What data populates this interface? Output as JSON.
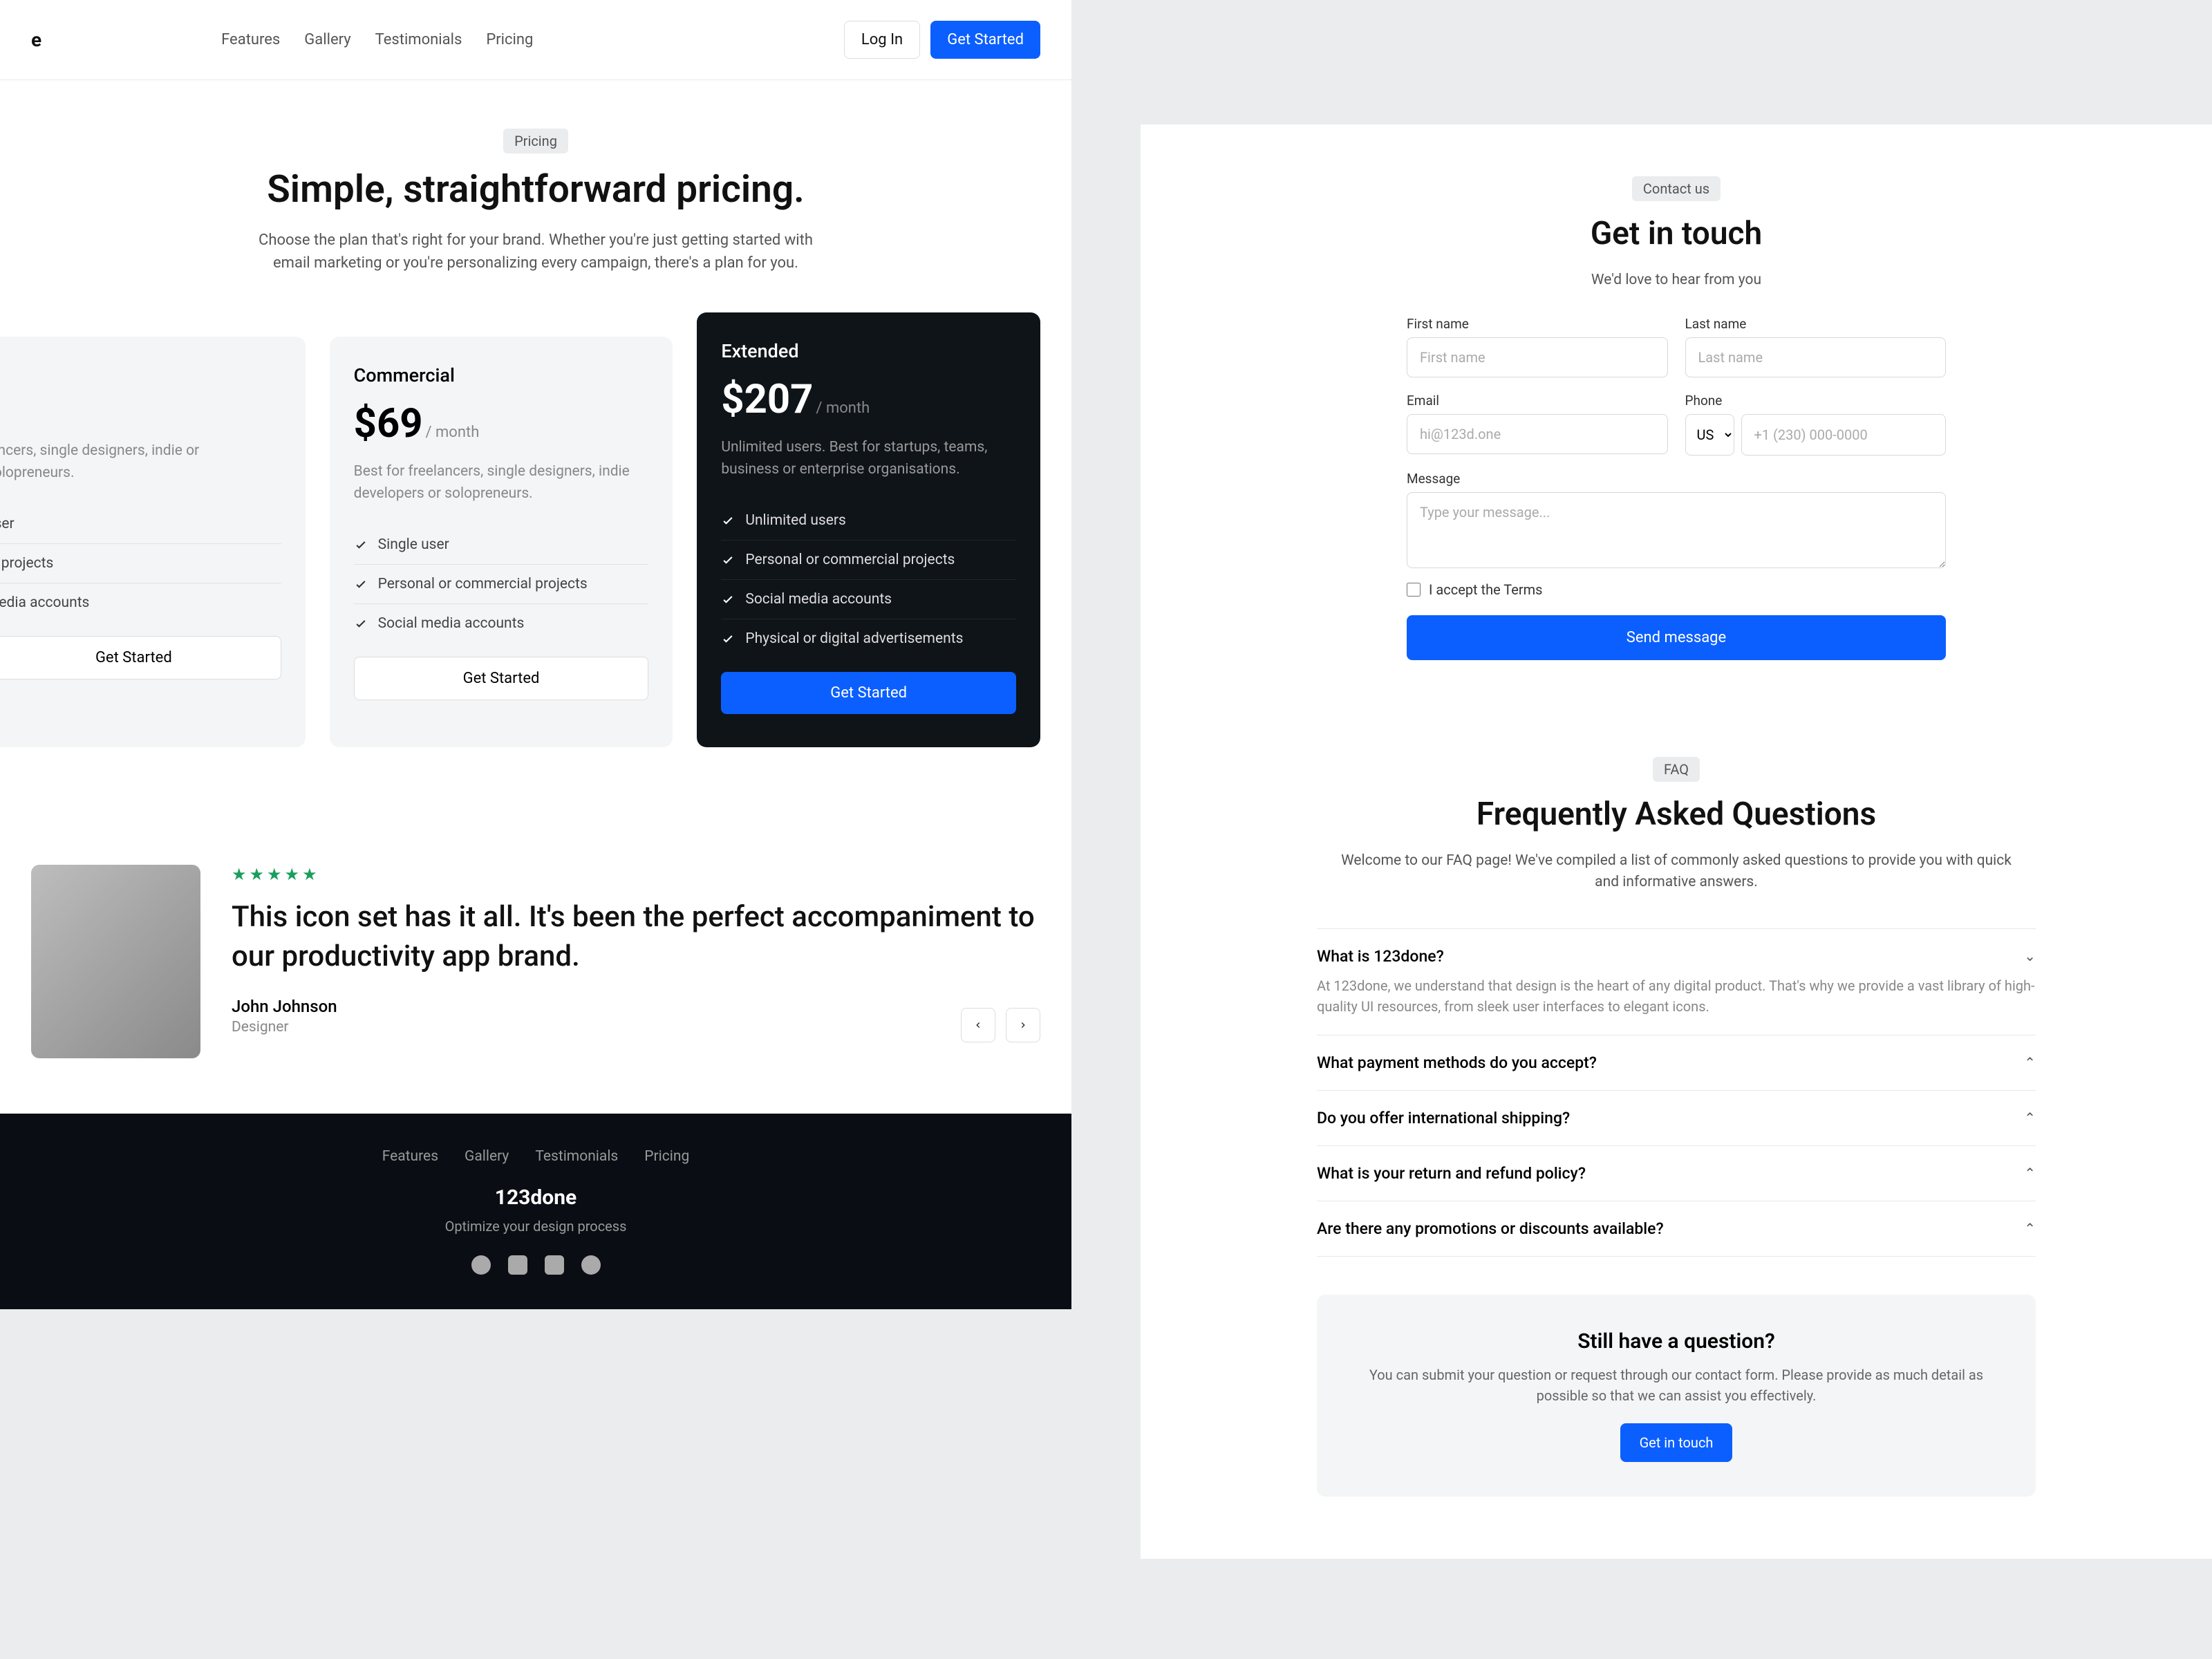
{
  "nav": {
    "logo": "e",
    "links": [
      "Features",
      "Gallery",
      "Testimonials",
      "Pricing"
    ],
    "login": "Log In",
    "getStarted": "Get Started"
  },
  "pricing": {
    "tag": "Pricing",
    "title": "Simple, straightforward pricing.",
    "sub": "Choose the plan that's right for your brand. Whether you're just getting started with email marketing or you're personalizing every campaign, there's a plan for you.",
    "cards": [
      {
        "name": "",
        "price": "",
        "unit": "",
        "desc": "lancers, single designers, indie or solopreneurs.",
        "features": [
          "user",
          "al projects",
          "media accounts"
        ],
        "cta": "Get Started"
      },
      {
        "name": "Commercial",
        "price": "$69",
        "unit": "/ month",
        "desc": "Best for freelancers, single designers, indie developers or solopreneurs.",
        "features": [
          "Single user",
          "Personal or commercial projects",
          "Social media accounts"
        ],
        "cta": "Get Started"
      },
      {
        "name": "Extended",
        "price": "$207",
        "unit": "/ month",
        "desc": "Unlimited users. Best for startups, teams, business or enterprise organisations.",
        "features": [
          "Unlimited users",
          "Personal or commercial projects",
          "Social media accounts",
          "Physical or digital advertisements"
        ],
        "cta": "Get Started"
      }
    ]
  },
  "testimonial": {
    "quote": "This icon set has it all. It's been the perfect accompaniment to our productivity app brand.",
    "author": "John Johnson",
    "role": "Designer"
  },
  "footer": {
    "links": [
      "Features",
      "Gallery",
      "Testimonials",
      "Pricing"
    ],
    "logo": "123done",
    "tagline": "Optimize your design process"
  },
  "contact": {
    "tag": "Contact us",
    "title": "Get in touch",
    "sub": "We'd love to hear from you",
    "fields": {
      "firstName": {
        "label": "First name",
        "ph": "First name"
      },
      "lastName": {
        "label": "Last name",
        "ph": "Last name"
      },
      "email": {
        "label": "Email",
        "ph": "hi@123d.one"
      },
      "phone": {
        "label": "Phone",
        "cc": "US",
        "ph": "+1 (230) 000-0000"
      },
      "message": {
        "label": "Message",
        "ph": "Type your message..."
      }
    },
    "terms": "I accept the Terms",
    "send": "Send message"
  },
  "faq": {
    "tag": "FAQ",
    "title": "Frequently Asked Questions",
    "sub": "Welcome to our FAQ page! We've compiled a list of commonly asked questions to provide you with quick and informative answers.",
    "items": [
      {
        "q": "What is 123done?",
        "a": "At 123done, we understand that design is the heart of any digital product. That's why we provide a vast library of high-quality UI resources, from sleek user interfaces to elegant icons.",
        "open": true
      },
      {
        "q": "What payment methods do you accept?",
        "open": false
      },
      {
        "q": "Do you offer international shipping?",
        "open": false
      },
      {
        "q": "What is your return and refund policy?",
        "open": false
      },
      {
        "q": "Are there any promotions or discounts available?",
        "open": false
      }
    ],
    "cta": {
      "title": "Still have a question?",
      "sub": "You can submit your question or request through our contact form. Please provide as much detail as possible so that we can assist you effectively.",
      "btn": "Get in touch"
    }
  }
}
